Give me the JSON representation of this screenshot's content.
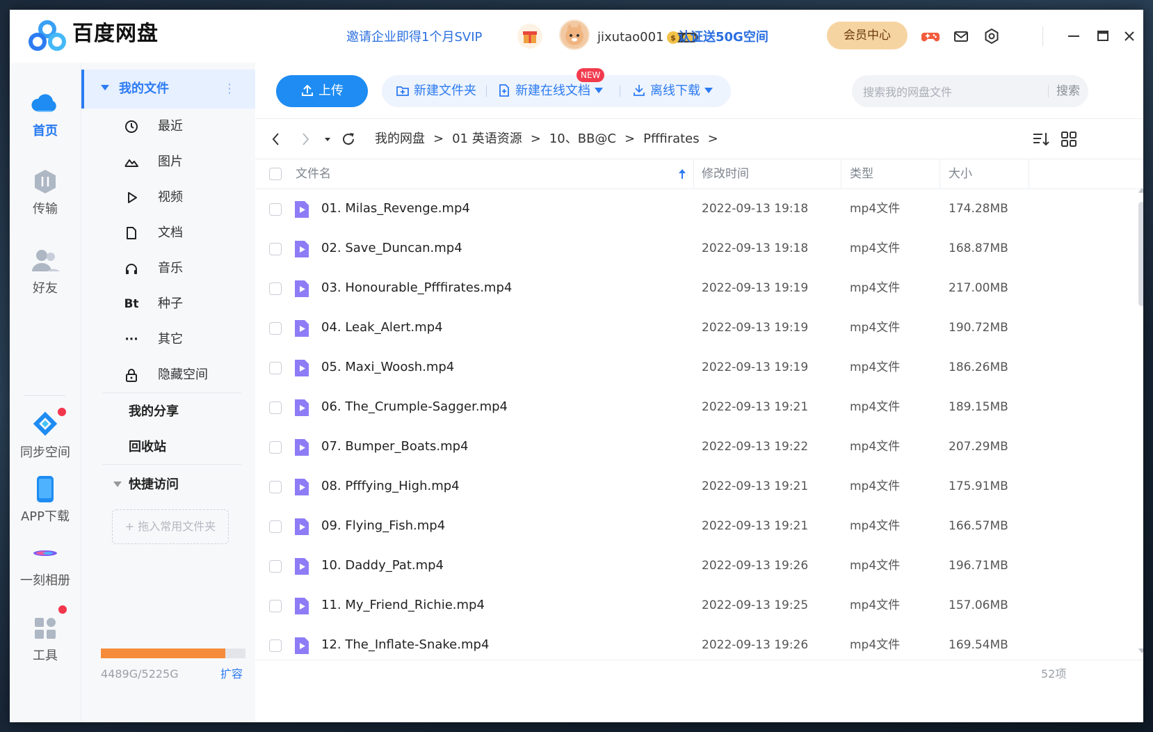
{
  "app": {
    "title": "百度网盘",
    "promo_enterprise": "邀请企业即得1个月SVIP",
    "username": "jixutao001",
    "promo_space": "认证送50G空间",
    "vip_center": "会员中心"
  },
  "leftnav": [
    {
      "label": "首页",
      "icon": "cloud-icon",
      "active": true
    },
    {
      "label": "传输",
      "icon": "transfer-icon"
    },
    {
      "label": "好友",
      "icon": "friends-icon"
    },
    {
      "label": "同步空间",
      "icon": "sync-icon"
    },
    {
      "label": "APP下载",
      "icon": "phone-icon"
    },
    {
      "label": "一刻相册",
      "icon": "album-icon"
    },
    {
      "label": "工具",
      "icon": "tools-icon"
    }
  ],
  "sidebar": {
    "my_files": "我的文件",
    "items": [
      {
        "label": "最近",
        "icon": "clock-icon"
      },
      {
        "label": "图片",
        "icon": "image-icon"
      },
      {
        "label": "视频",
        "icon": "play-icon"
      },
      {
        "label": "文档",
        "icon": "document-icon"
      },
      {
        "label": "音乐",
        "icon": "headphones-icon"
      },
      {
        "label": "种子",
        "icon": "bt-icon",
        "glyph": "Bt"
      },
      {
        "label": "其它",
        "icon": "more-icon",
        "glyph": "···"
      },
      {
        "label": "隐藏空间",
        "icon": "lock-icon"
      }
    ],
    "my_share": "我的分享",
    "recycle": "回收站",
    "quick_access": "快捷访问",
    "drop_hint": "+ 拖入常用文件夹",
    "storage_text": "4489G/5225G",
    "storage_used_fraction": 0.859,
    "expand": "扩容"
  },
  "toolbar": {
    "upload": "上传",
    "new_folder": "新建文件夹",
    "new_online_doc": "新建在线文档",
    "new_badge": "NEW",
    "offline_download": "离线下载",
    "search_placeholder": "搜索我的网盘文件",
    "search_button": "搜索"
  },
  "breadcrumb": [
    "我的网盘",
    "01 英语资源",
    "10、BB@C",
    "Pfffirates"
  ],
  "breadcrumb_sep": ">",
  "columns": {
    "name": "文件名",
    "modified": "修改时间",
    "type": "类型",
    "size": "大小"
  },
  "files": [
    {
      "name": "01. Milas_Revenge.mp4",
      "modified": "2022-09-13 19:18",
      "type": "mp4文件",
      "size": "174.28MB"
    },
    {
      "name": "02. Save_Duncan.mp4",
      "modified": "2022-09-13 19:18",
      "type": "mp4文件",
      "size": "168.87MB"
    },
    {
      "name": "03. Honourable_Pfffirates.mp4",
      "modified": "2022-09-13 19:19",
      "type": "mp4文件",
      "size": "217.00MB"
    },
    {
      "name": "04. Leak_Alert.mp4",
      "modified": "2022-09-13 19:19",
      "type": "mp4文件",
      "size": "190.72MB"
    },
    {
      "name": "05. Maxi_Woosh.mp4",
      "modified": "2022-09-13 19:19",
      "type": "mp4文件",
      "size": "186.26MB"
    },
    {
      "name": "06. The_Crumple-Sagger.mp4",
      "modified": "2022-09-13 19:21",
      "type": "mp4文件",
      "size": "189.15MB"
    },
    {
      "name": "07. Bumper_Boats.mp4",
      "modified": "2022-09-13 19:22",
      "type": "mp4文件",
      "size": "207.29MB"
    },
    {
      "name": "08. Pfffying_High.mp4",
      "modified": "2022-09-13 19:21",
      "type": "mp4文件",
      "size": "175.91MB"
    },
    {
      "name": "09. Flying_Fish.mp4",
      "modified": "2022-09-13 19:21",
      "type": "mp4文件",
      "size": "166.57MB"
    },
    {
      "name": "10. Daddy_Pat.mp4",
      "modified": "2022-09-13 19:26",
      "type": "mp4文件",
      "size": "196.71MB"
    },
    {
      "name": "11. My_Friend_Richie.mp4",
      "modified": "2022-09-13 19:25",
      "type": "mp4文件",
      "size": "157.06MB"
    },
    {
      "name": "12. The_Inflate-Snake.mp4",
      "modified": "2022-09-13 19:26",
      "type": "mp4文件",
      "size": "169.54MB"
    }
  ],
  "item_count": "52项",
  "colors": {
    "accent": "#2c7bf2",
    "upload_button": "#1e8cf2",
    "storage_fill": "#f68c3b",
    "video_file_icon": "#8e7cf6",
    "vip_button": "#f6d4a2"
  }
}
